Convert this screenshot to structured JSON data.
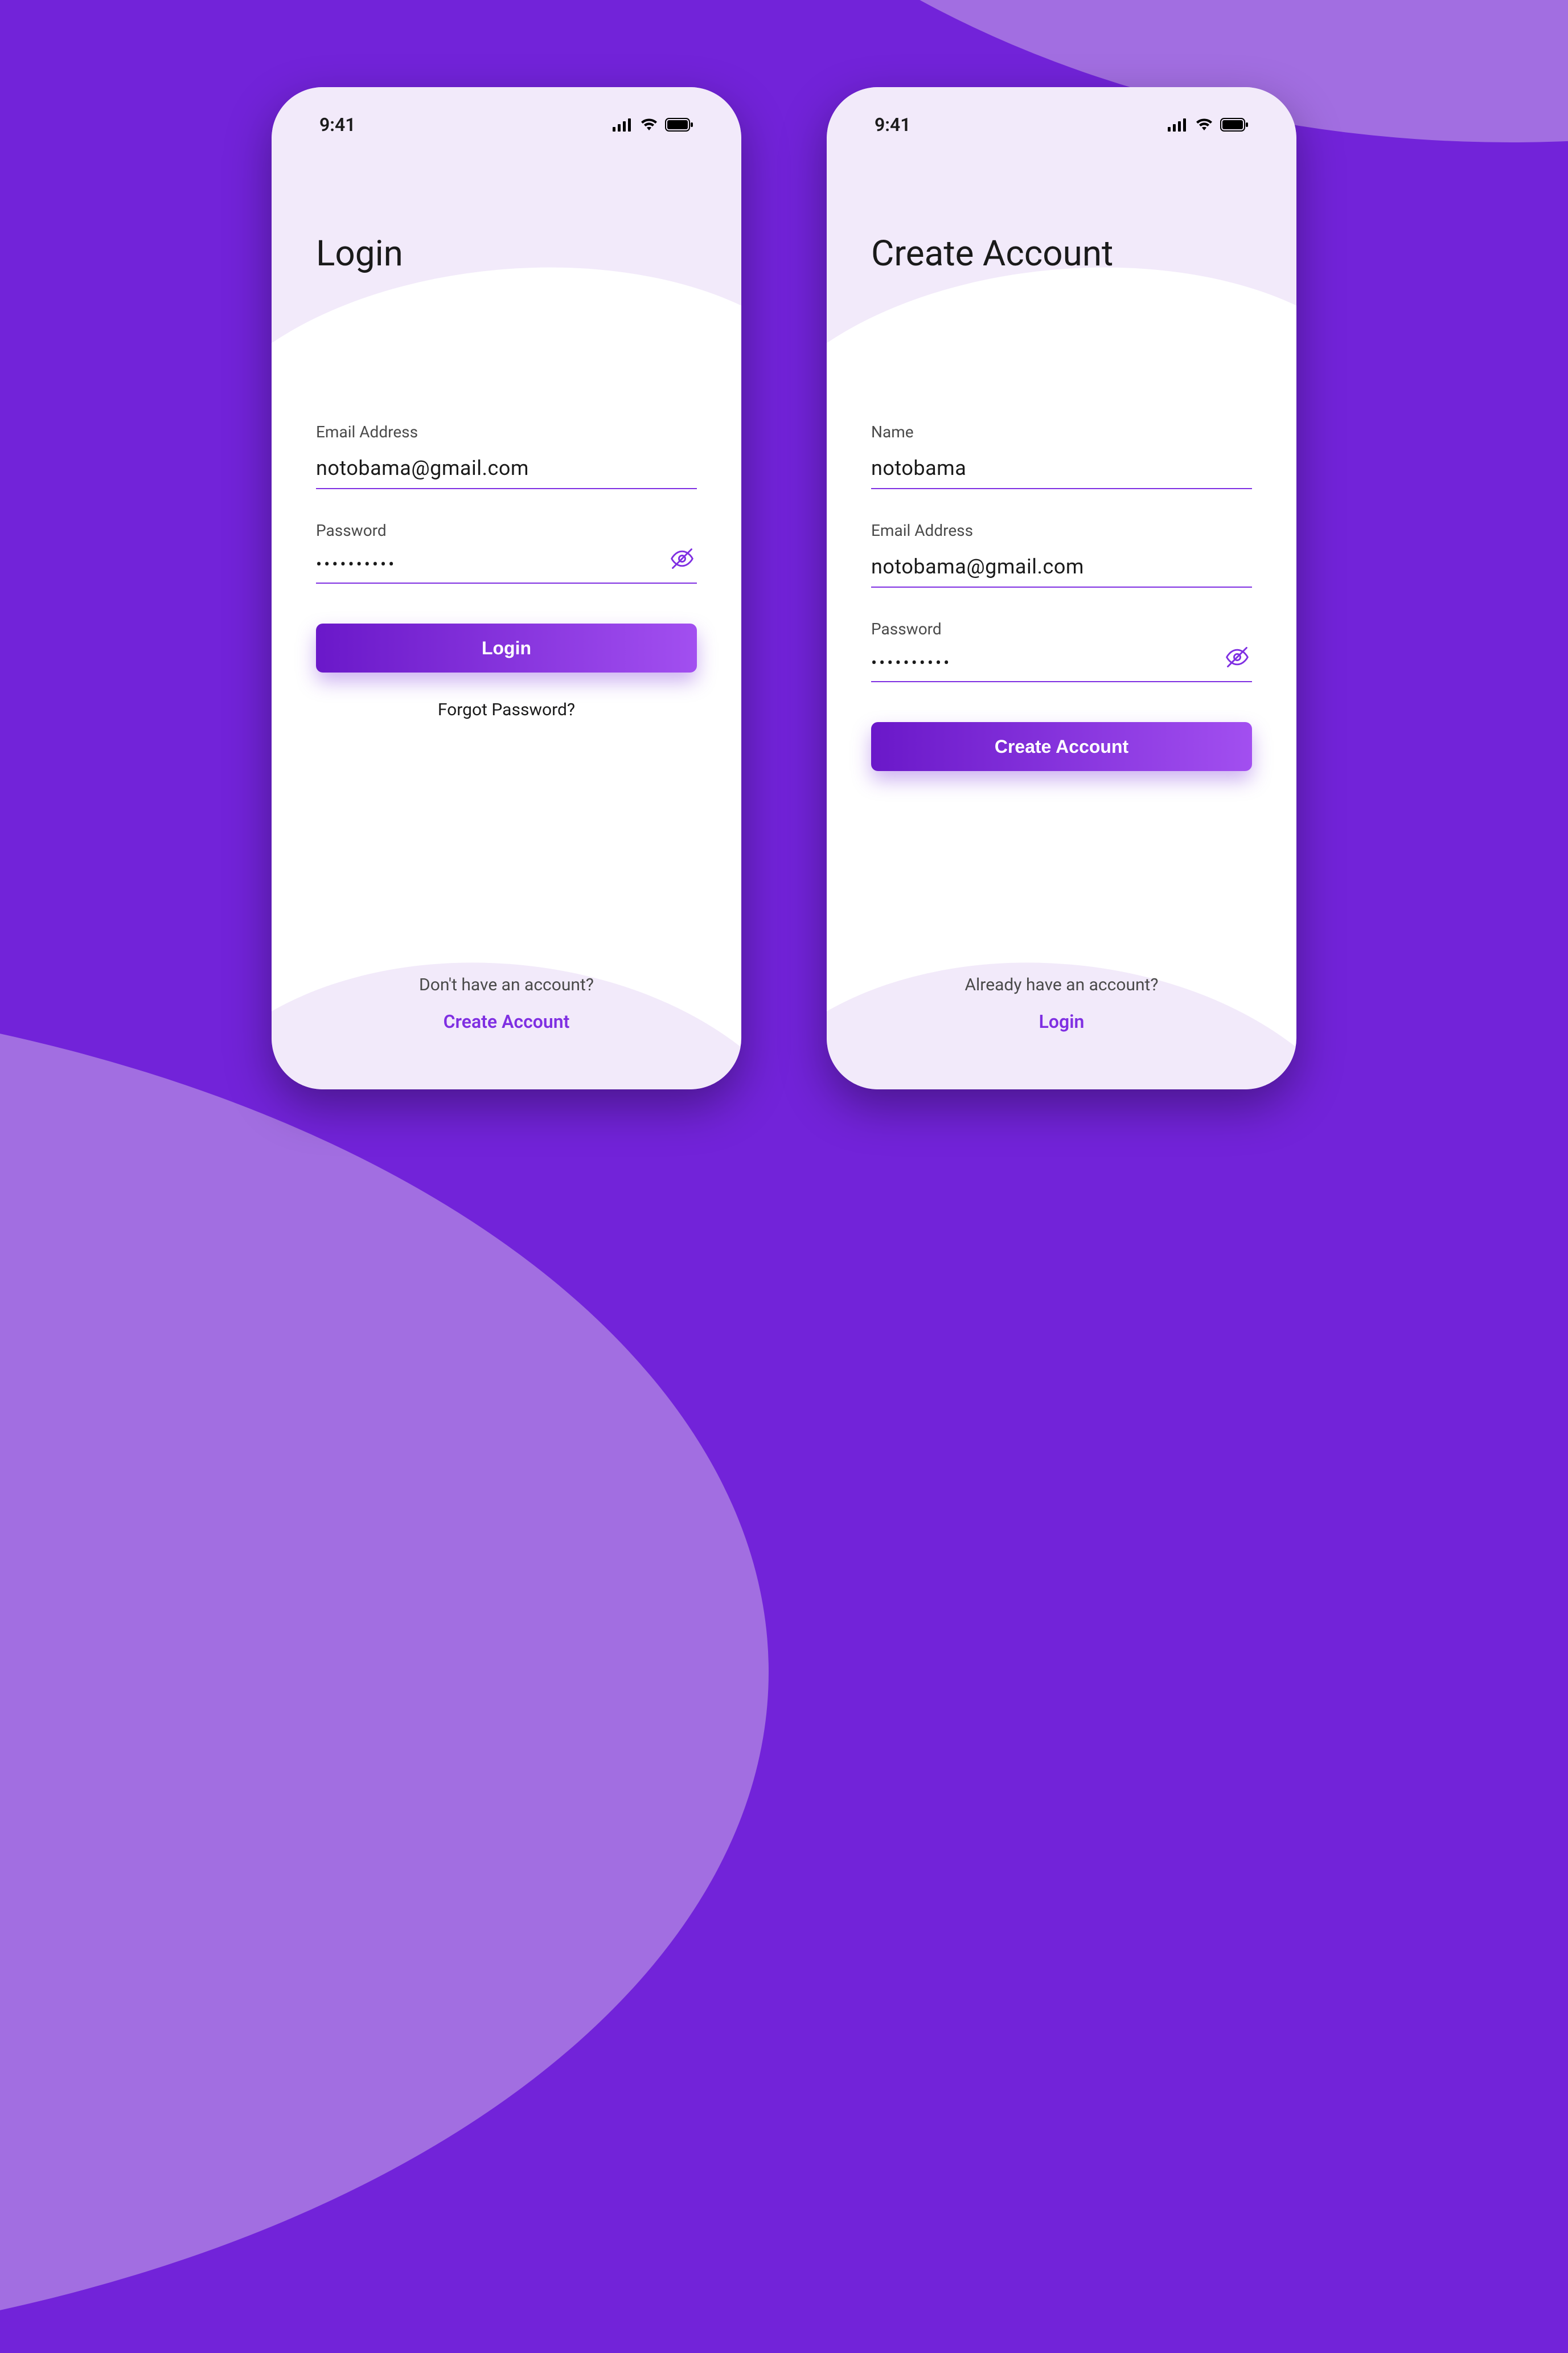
{
  "status": {
    "time": "9:41"
  },
  "colors": {
    "accent": "#7f2fe2",
    "bg_dark": "#7223d9",
    "bg_light": "#a26ee1",
    "header_tint": "#f2eafa"
  },
  "login": {
    "title": "Login",
    "email_label": "Email Address",
    "email_value": "notobama@gmail.com",
    "password_label": "Password",
    "password_value": "**********",
    "submit_label": "Login",
    "forgot_label": "Forgot Password?",
    "footer_prompt": "Don't have an account?",
    "footer_link": "Create Account"
  },
  "signup": {
    "title": "Create Account",
    "name_label": "Name",
    "name_value": "notobama",
    "email_label": "Email Address",
    "email_value": "notobama@gmail.com",
    "password_label": "Password",
    "password_value": "**********",
    "submit_label": "Create Account",
    "footer_prompt": "Already have an account?",
    "footer_link": "Login"
  }
}
